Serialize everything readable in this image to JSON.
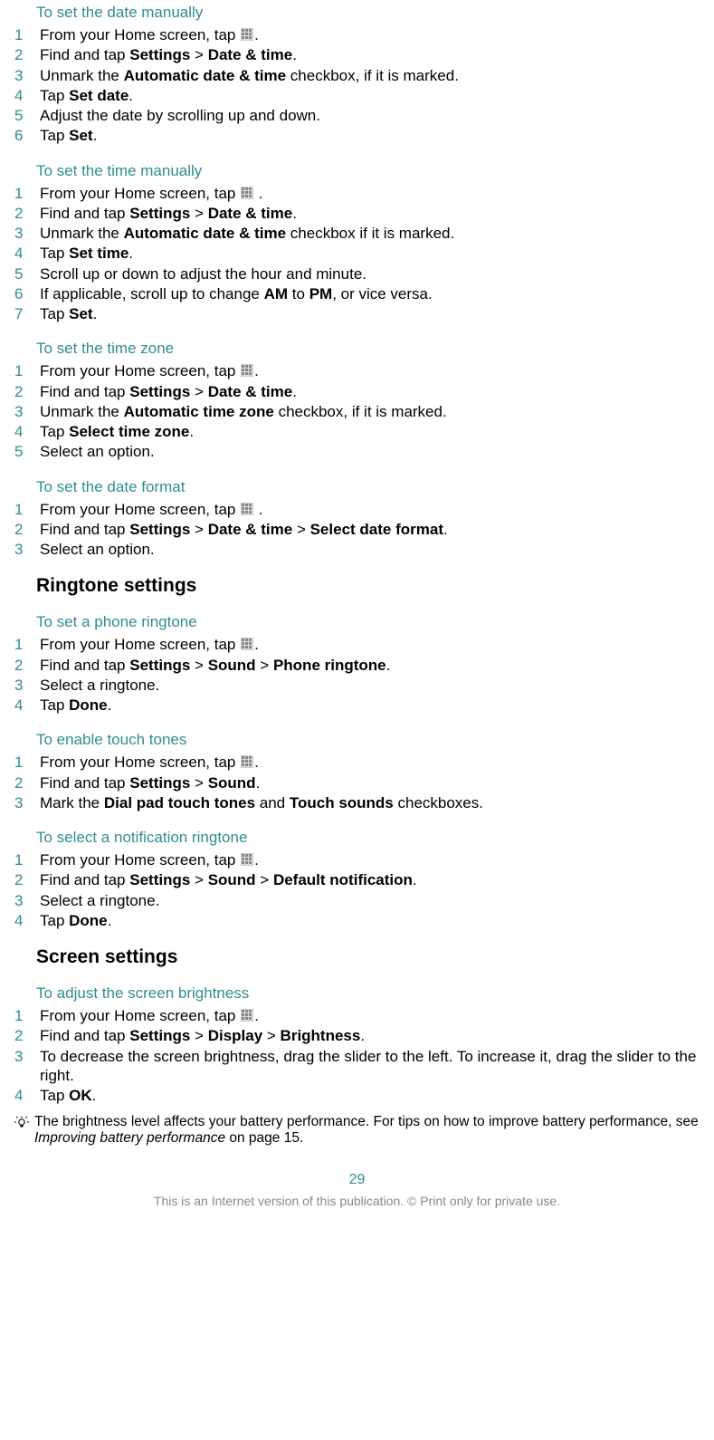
{
  "icons": {
    "apps": "apps-icon",
    "tip": "tip-bulb-icon"
  },
  "sections": [
    {
      "title": "To set the date manually",
      "steps": [
        {
          "n": "1",
          "parts": [
            "From your Home screen, tap ",
            {
              "icon": "apps"
            },
            "."
          ]
        },
        {
          "n": "2",
          "parts": [
            "Find and tap ",
            {
              "b": "Settings"
            },
            " > ",
            {
              "b": "Date & time"
            },
            "."
          ]
        },
        {
          "n": "3",
          "parts": [
            "Unmark the ",
            {
              "b": "Automatic date & time"
            },
            " checkbox, if it is marked."
          ]
        },
        {
          "n": "4",
          "parts": [
            "Tap ",
            {
              "b": "Set date"
            },
            "."
          ]
        },
        {
          "n": "5",
          "parts": [
            "Adjust the date by scrolling up and down."
          ]
        },
        {
          "n": "6",
          "parts": [
            "Tap ",
            {
              "b": "Set"
            },
            "."
          ]
        }
      ]
    },
    {
      "title": "To set the time manually",
      "steps": [
        {
          "n": "1",
          "parts": [
            "From your Home screen, tap ",
            {
              "icon": "apps"
            },
            " ."
          ]
        },
        {
          "n": "2",
          "parts": [
            "Find and tap ",
            {
              "b": "Settings"
            },
            " > ",
            {
              "b": "Date & time"
            },
            "."
          ]
        },
        {
          "n": "3",
          "parts": [
            "Unmark the ",
            {
              "b": "Automatic date & time"
            },
            " checkbox if it is marked."
          ]
        },
        {
          "n": "4",
          "parts": [
            "Tap ",
            {
              "b": "Set time"
            },
            "."
          ]
        },
        {
          "n": "5",
          "parts": [
            "Scroll up or down to adjust the hour and minute."
          ]
        },
        {
          "n": "6",
          "parts": [
            "If applicable, scroll up to change ",
            {
              "b": "AM"
            },
            " to ",
            {
              "b": "PM"
            },
            ", or vice versa."
          ]
        },
        {
          "n": "7",
          "parts": [
            "Tap ",
            {
              "b": "Set"
            },
            "."
          ]
        }
      ]
    },
    {
      "title": "To set the time zone",
      "steps": [
        {
          "n": "1",
          "parts": [
            "From your Home screen, tap ",
            {
              "icon": "apps"
            },
            "."
          ]
        },
        {
          "n": "2",
          "parts": [
            "Find and tap ",
            {
              "b": "Settings"
            },
            " > ",
            {
              "b": "Date & time"
            },
            "."
          ]
        },
        {
          "n": "3",
          "parts": [
            "Unmark the ",
            {
              "b": "Automatic time zone"
            },
            " checkbox, if it is marked."
          ]
        },
        {
          "n": "4",
          "parts": [
            "Tap ",
            {
              "b": "Select time zone"
            },
            "."
          ]
        },
        {
          "n": "5",
          "parts": [
            "Select an option."
          ]
        }
      ]
    },
    {
      "title": "To set the date format",
      "steps": [
        {
          "n": "1",
          "parts": [
            "From your Home screen, tap ",
            {
              "icon": "apps"
            },
            " ."
          ]
        },
        {
          "n": "2",
          "parts": [
            "Find and tap ",
            {
              "b": "Settings"
            },
            " > ",
            {
              "b": "Date & time"
            },
            " > ",
            {
              "b": "Select date format"
            },
            "."
          ]
        },
        {
          "n": "3",
          "parts": [
            "Select an option."
          ]
        }
      ]
    },
    {
      "heading": "Ringtone settings"
    },
    {
      "title": "To set a phone ringtone",
      "steps": [
        {
          "n": "1",
          "parts": [
            "From your Home screen, tap ",
            {
              "icon": "apps"
            },
            "."
          ]
        },
        {
          "n": "2",
          "parts": [
            "Find and tap ",
            {
              "b": "Settings"
            },
            " > ",
            {
              "b": "Sound"
            },
            " > ",
            {
              "b": "Phone ringtone"
            },
            "."
          ]
        },
        {
          "n": "3",
          "parts": [
            "Select a ringtone."
          ]
        },
        {
          "n": "4",
          "parts": [
            "Tap ",
            {
              "b": "Done"
            },
            "."
          ]
        }
      ]
    },
    {
      "title": "To enable touch tones",
      "steps": [
        {
          "n": "1",
          "parts": [
            "From your Home screen, tap ",
            {
              "icon": "apps"
            },
            "."
          ]
        },
        {
          "n": "2",
          "parts": [
            "Find and tap ",
            {
              "b": "Settings"
            },
            " > ",
            {
              "b": "Sound"
            },
            "."
          ]
        },
        {
          "n": "3",
          "parts": [
            "Mark the ",
            {
              "b": "Dial pad touch tones"
            },
            " and ",
            {
              "b": "Touch sounds"
            },
            " checkboxes."
          ]
        }
      ]
    },
    {
      "title": "To select a notification ringtone",
      "steps": [
        {
          "n": "1",
          "parts": [
            "From your Home screen, tap ",
            {
              "icon": "apps"
            },
            "."
          ]
        },
        {
          "n": "2",
          "parts": [
            "Find and tap ",
            {
              "b": "Settings"
            },
            " > ",
            {
              "b": "Sound"
            },
            " > ",
            {
              "b": "Default notification"
            },
            "."
          ]
        },
        {
          "n": "3",
          "parts": [
            "Select a ringtone."
          ]
        },
        {
          "n": "4",
          "parts": [
            "Tap ",
            {
              "b": "Done"
            },
            "."
          ]
        }
      ]
    },
    {
      "heading": "Screen settings"
    },
    {
      "title": "To adjust the screen brightness",
      "steps": [
        {
          "n": "1",
          "parts": [
            "From your Home screen, tap ",
            {
              "icon": "apps"
            },
            "."
          ]
        },
        {
          "n": "2",
          "parts": [
            "Find and tap ",
            {
              "b": "Settings"
            },
            " > ",
            {
              "b": "Display"
            },
            " > ",
            {
              "b": "Brightness"
            },
            "."
          ]
        },
        {
          "n": "3",
          "parts": [
            "To decrease the screen brightness, drag the slider to the left. To increase it, drag the slider to the right."
          ]
        },
        {
          "n": "4",
          "parts": [
            "Tap ",
            {
              "b": "OK"
            },
            "."
          ]
        }
      ],
      "tip": [
        "The brightness level affects your battery performance. For tips on how to improve battery performance, see ",
        {
          "i": "Improving battery performance"
        },
        " on page 15."
      ]
    }
  ],
  "page_number": "29",
  "footer": "This is an Internet version of this publication. © Print only for private use."
}
